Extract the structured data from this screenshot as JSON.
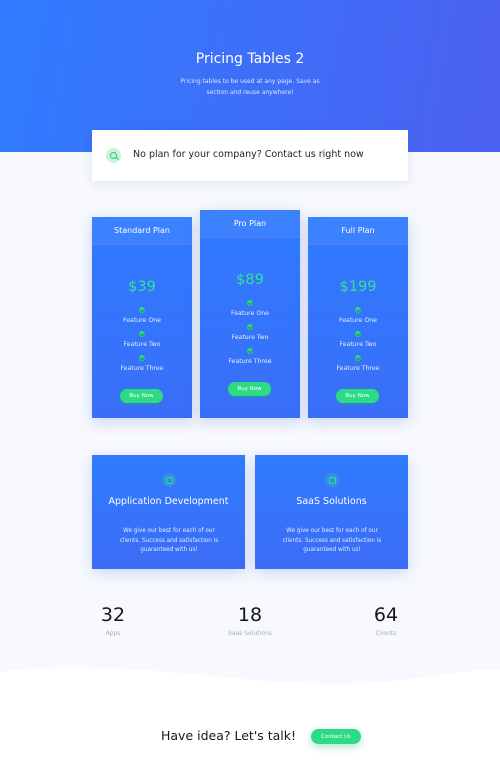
{
  "hero": {
    "title": "Pricing Tables 2",
    "subtitle": "Pricing tables to be used at any page. Save as section and reuse anywhere!"
  },
  "contact_bar": {
    "icon": "search-icon",
    "text": "No plan for your company? Contact us right now"
  },
  "plans": [
    {
      "name": "Standard Plan",
      "price": "$39",
      "features": [
        "Feature One",
        "Feature Two",
        "Feature Three"
      ],
      "button": "Buy Now"
    },
    {
      "name": "Pro Plan",
      "price": "$89",
      "features": [
        "Feature One",
        "Feature Two",
        "Feature Three"
      ],
      "button": "Buy Now"
    },
    {
      "name": "Full Plan",
      "price": "$199",
      "features": [
        "Feature One",
        "Feature Two",
        "Feature Three"
      ],
      "button": "Buy Now"
    }
  ],
  "services": [
    {
      "icon": "smile-icon",
      "title": "Application Development",
      "description": "We give our best for each of our clients. Success and satisfaction is guaranteed with us!"
    },
    {
      "icon": "grid-icon",
      "title": "SaaS Solutions",
      "description": "We give our best for each of our clients. Success and satisfaction is guaranteed with us!"
    }
  ],
  "stats": [
    {
      "value": "32",
      "label": "Apps"
    },
    {
      "value": "18",
      "label": "Saas Solutions"
    },
    {
      "value": "64",
      "label": "Clients"
    }
  ],
  "cta": {
    "text": "Have idea? Let's talk!",
    "button": "Contact Us"
  },
  "colors": {
    "primary_blue": "#2f7bff",
    "accent_green": "#2ddb85",
    "background": "#f7f9fe"
  }
}
